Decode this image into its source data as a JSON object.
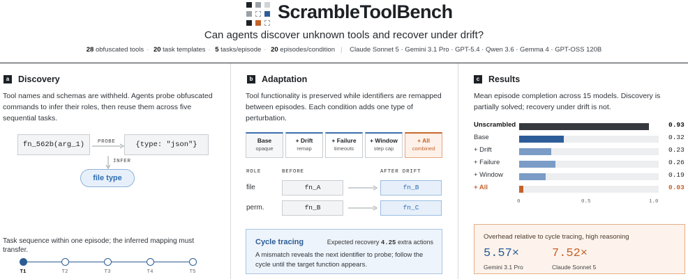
{
  "header": {
    "title": "ScrambleToolBench",
    "subtitle": "Can agents discover unknown tools and recover under drift?",
    "stats": [
      {
        "value": "28",
        "label": "obfuscated tools"
      },
      {
        "value": "20",
        "label": "task templates"
      },
      {
        "value": "5",
        "label": "tasks/episode"
      },
      {
        "value": "20",
        "label": "episodes/condition"
      }
    ],
    "models": "Claude Sonnet 5 · Gemini 3.1 Pro · GPT-5.4 · Qwen 3.6 · Gemma 4 · GPT-OSS 120B"
  },
  "discovery": {
    "badge": "a",
    "title": "Discovery",
    "description": "Tool names and schemas are withheld. Agents probe obfuscated commands to infer their roles, then reuse them across five sequential tasks.",
    "call": "fn_562b(arg_1)",
    "probe_label": "PROBE",
    "response": "{type: \"json\"}",
    "infer_label": "INFER",
    "inferred": "file type",
    "sequence_text": "Task sequence within one episode; the inferred mapping must transfer.",
    "tasks": [
      "T1",
      "T2",
      "T3",
      "T4",
      "T5"
    ]
  },
  "adaptation": {
    "badge": "b",
    "title": "Adaptation",
    "description": "Tool functionality is preserved while identifiers are remapped between episodes. Each condition adds one type of perturbation.",
    "conditions": [
      {
        "name": "Base",
        "sub": "opaque"
      },
      {
        "name": "+ Drift",
        "sub": "remap"
      },
      {
        "name": "+ Failure",
        "sub": "timeouts"
      },
      {
        "name": "+ Window",
        "sub": "step cap"
      },
      {
        "name": "+ All",
        "sub": "combined"
      }
    ],
    "col_role": "ROLE",
    "col_before": "BEFORE",
    "col_after": "AFTER DRIFT",
    "mappings": [
      {
        "role": "file",
        "before": "fn_A",
        "after": "fn_B"
      },
      {
        "role": "perm.",
        "before": "fn_B",
        "after": "fn_C"
      }
    ],
    "cycle": {
      "title": "Cycle tracing",
      "recovery_prefix": "Expected recovery",
      "recovery_value": "4.25",
      "recovery_suffix": "extra actions",
      "description": "A mismatch reveals the next identifier to probe; follow the cycle until the target function appears."
    }
  },
  "results": {
    "badge": "c",
    "title": "Results",
    "description": "Mean episode completion across 15 models. Discovery is partially solved; recovery under drift is not.",
    "ticks": [
      "0",
      "0.5",
      "1.0"
    ],
    "overhead_title": "Overhead relative to cycle tracing, high reasoning",
    "overhead": [
      {
        "value": "5.57×",
        "model": "Gemini 3.1 Pro",
        "color": "#2b5c94"
      },
      {
        "value": "7.52×",
        "model": "Claude Sonnet 5",
        "color": "#c4622a"
      }
    ]
  },
  "chart_data": {
    "type": "bar",
    "orientation": "horizontal",
    "categories": [
      "Unscrambled",
      "Base",
      "+ Drift",
      "+ Failure",
      "+ Window",
      "+ All"
    ],
    "values": [
      0.93,
      0.32,
      0.23,
      0.26,
      0.19,
      0.03
    ],
    "value_labels": [
      "0.93",
      "0.32",
      "0.23",
      "0.26",
      "0.19",
      "0.03"
    ],
    "xlim": [
      0,
      1.0
    ],
    "colors": [
      "#363a3f",
      "#2d5d99",
      "#7a9cc6",
      "#7a9cc6",
      "#7a9cc6",
      "#c4622a"
    ]
  }
}
